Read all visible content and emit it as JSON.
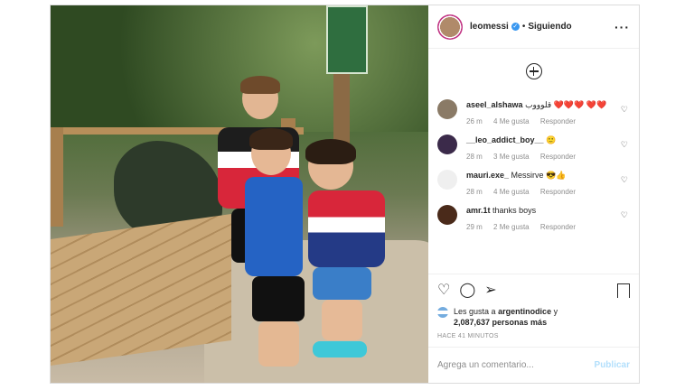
{
  "post": {
    "username": "leomessi",
    "follow_status": "Siguiendo",
    "more_icon": "more-horizontal-icon"
  },
  "comments": [
    {
      "user": "aseel_alshawa",
      "text": "قلوووب ❤️❤️❤️ ❤️❤️",
      "age": "26 m",
      "likes": "4 Me gusta",
      "reply": "Responder",
      "avatar_color": "#8a7a66"
    },
    {
      "user": "__leo_addict_boy__",
      "text": "🙂",
      "age": "28 m",
      "likes": "3 Me gusta",
      "reply": "Responder",
      "avatar_color": "#3b2a4a"
    },
    {
      "user": "mauri.exe_",
      "text": "Messirve 😎👍",
      "age": "28 m",
      "likes": "4 Me gusta",
      "reply": "Responder",
      "avatar_color": "#efefef"
    },
    {
      "user": "amr.1t",
      "text": "thanks boys",
      "age": "29 m",
      "likes": "2 Me gusta",
      "reply": "Responder",
      "avatar_color": "#4a2a1a"
    }
  ],
  "likes": {
    "prefix": "Les gusta a",
    "user": "argentinodice",
    "joiner": "y",
    "count": "2,087,637 personas más"
  },
  "timestamp": "HACE 41 MINUTOS",
  "comment_box": {
    "placeholder": "Agrega un comentario...",
    "publish_label": "Publicar"
  }
}
